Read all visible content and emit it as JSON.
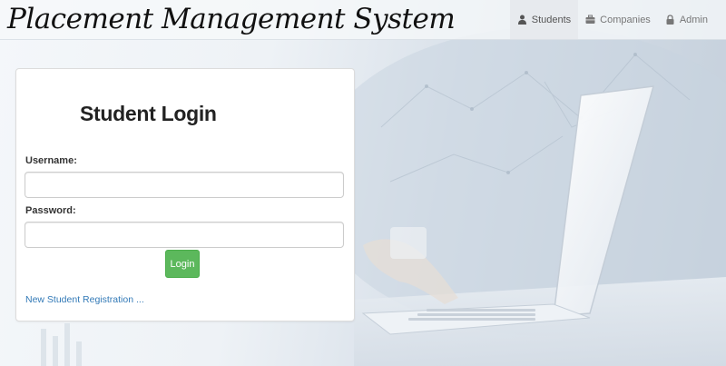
{
  "navbar": {
    "brand": "Placement Management System",
    "items": [
      {
        "label": "Students",
        "icon": "user-icon",
        "active": true
      },
      {
        "label": "Companies",
        "icon": "briefcase-icon",
        "active": false
      },
      {
        "label": "Admin",
        "icon": "lock-icon",
        "active": false
      }
    ]
  },
  "login": {
    "title": "Student Login",
    "username_label": "Username:",
    "username_value": "",
    "password_label": "Password:",
    "password_value": "",
    "submit_label": "Login",
    "register_link": "New Student Registration ..."
  },
  "colors": {
    "login_button": "#5cb85c",
    "link": "#337ab7",
    "active_nav_bg": "#e7eaee"
  }
}
